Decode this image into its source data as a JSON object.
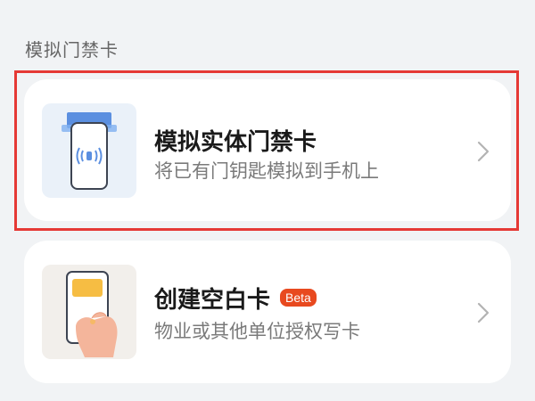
{
  "section": {
    "title": "模拟门禁卡"
  },
  "cards": [
    {
      "title": "模拟实体门禁卡",
      "subtitle": "将已有门钥匙模拟到手机上",
      "icon": "phone-nfc-icon",
      "selected": true
    },
    {
      "title": "创建空白卡",
      "badge": "Beta",
      "subtitle": "物业或其他单位授权写卡",
      "icon": "hand-holding-phone-icon"
    }
  ],
  "colors": {
    "background": "#f1f3f5",
    "card": "#ffffff",
    "highlight_border": "#e53935",
    "badge": "#e8491f"
  }
}
